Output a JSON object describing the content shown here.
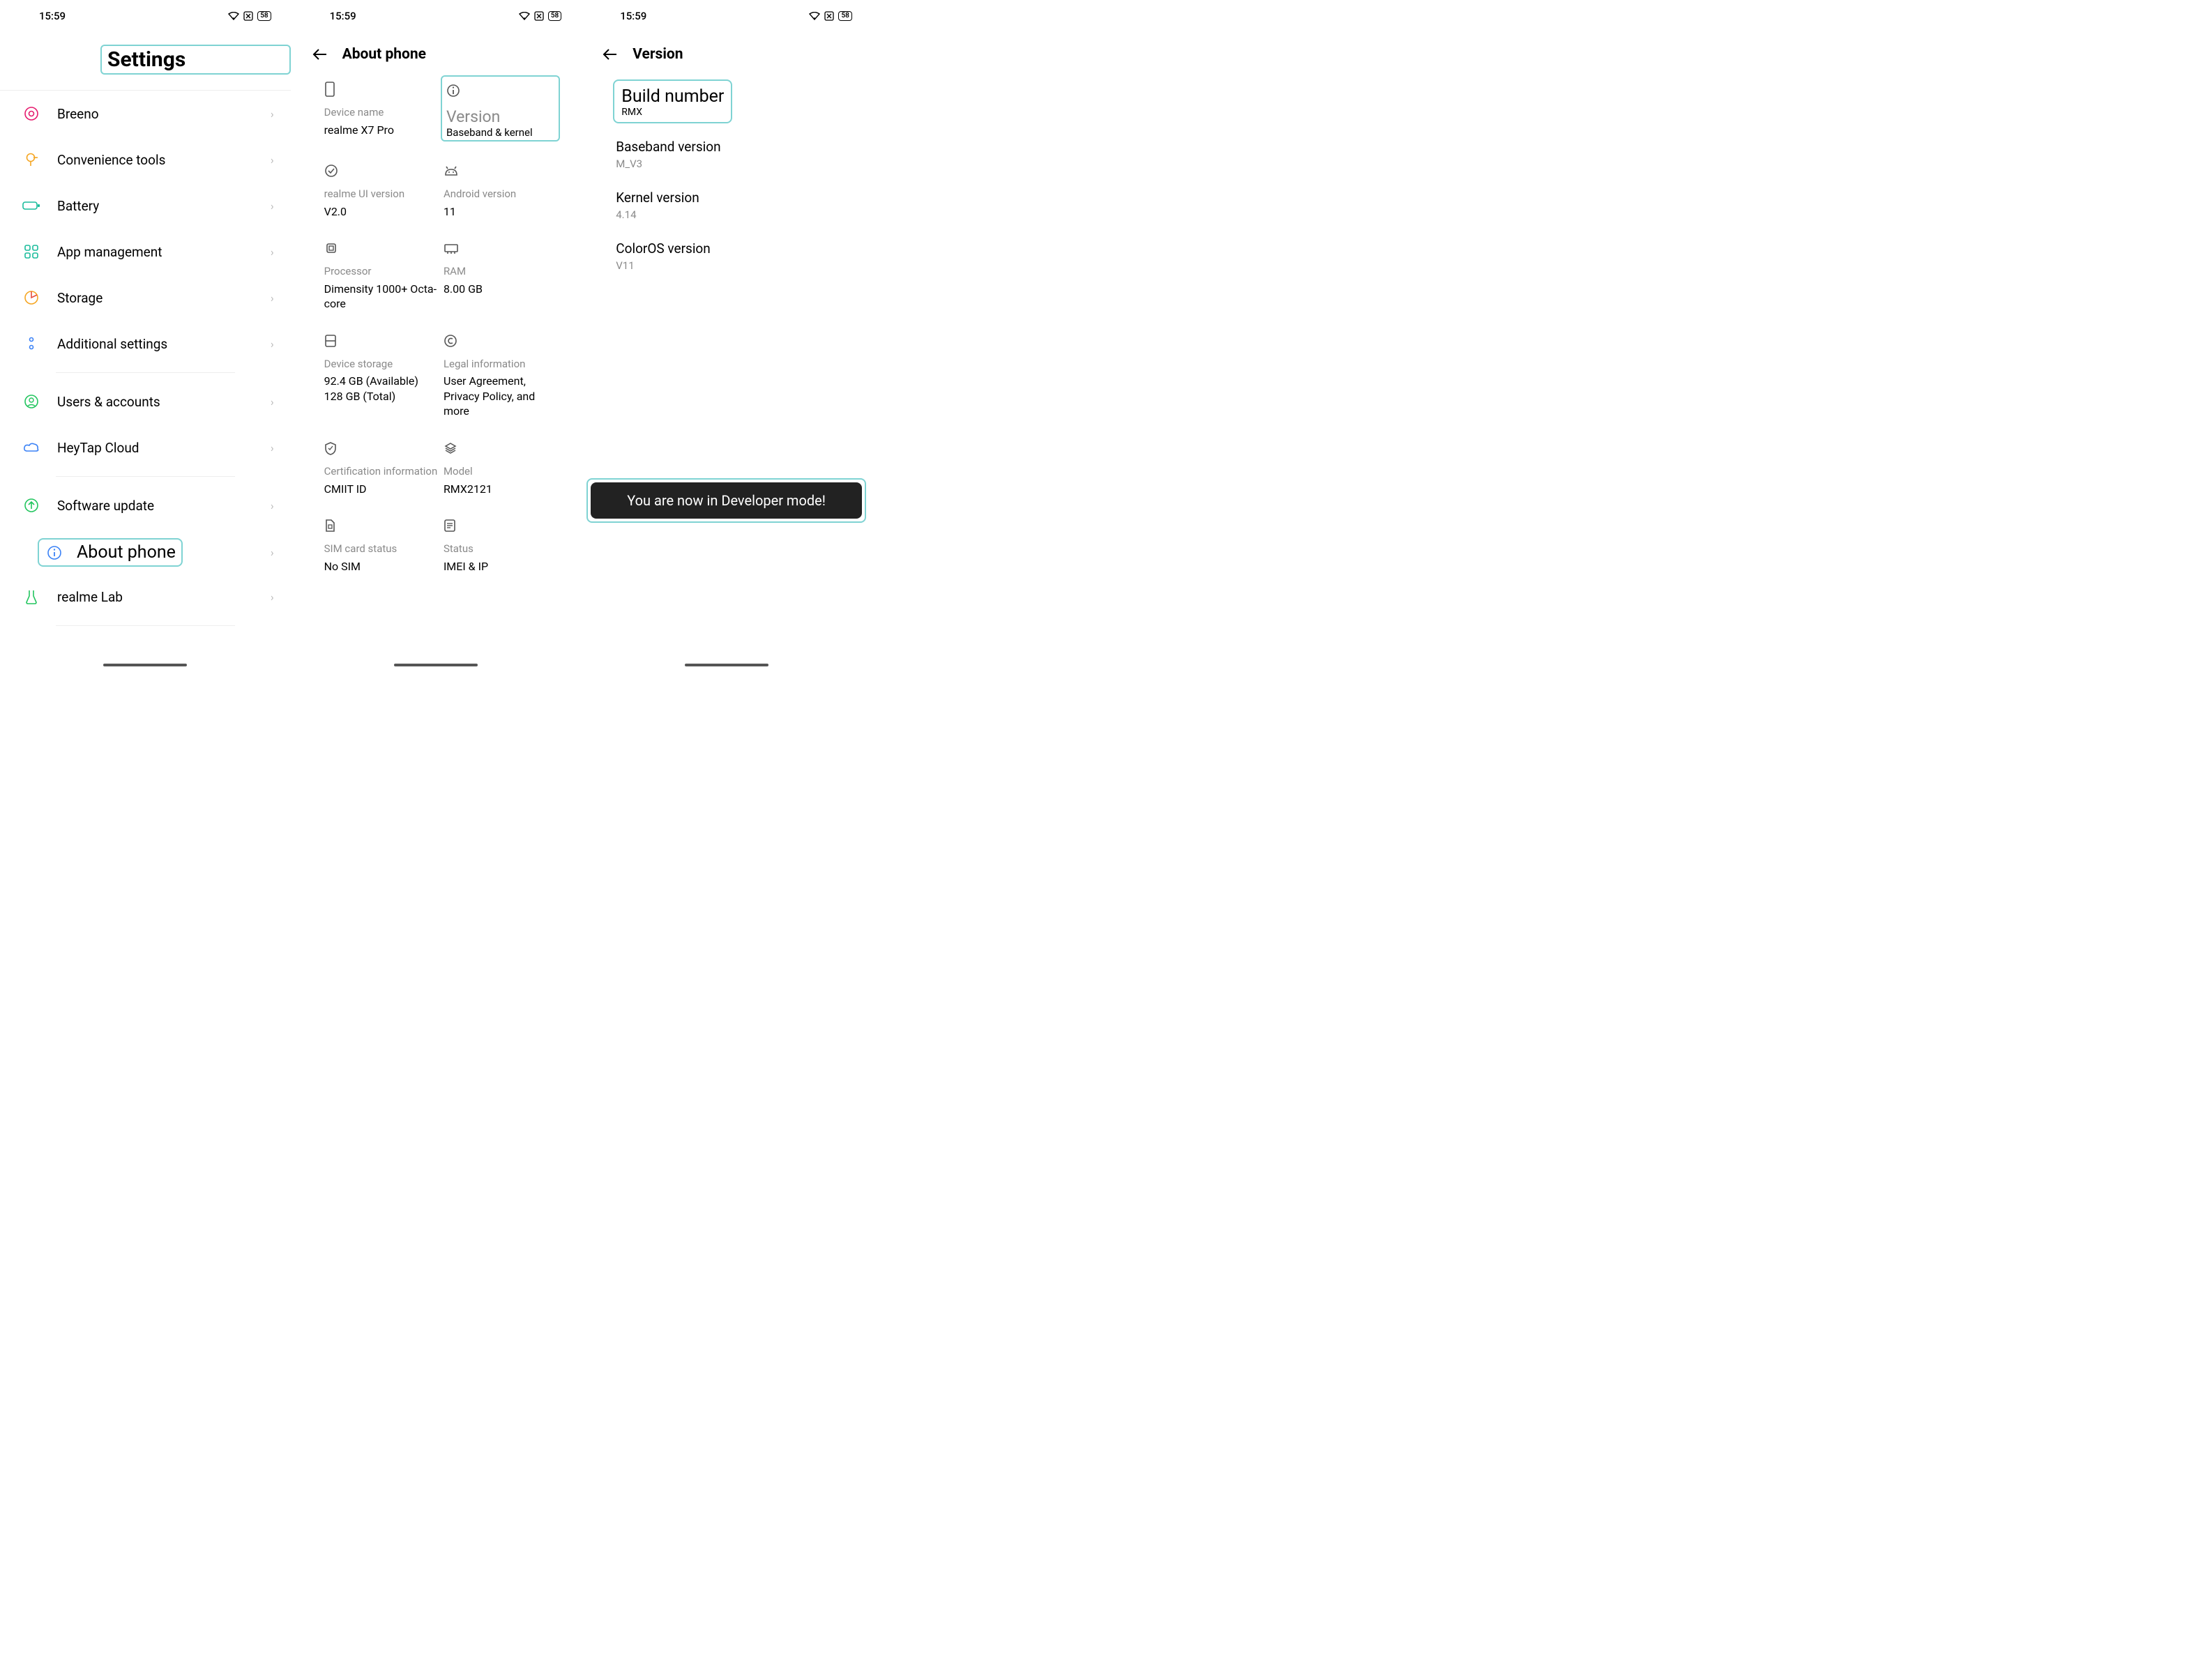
{
  "status": {
    "time": "15:59",
    "battery": "58"
  },
  "screen1": {
    "title": "Settings",
    "items": [
      {
        "label": "Breeno"
      },
      {
        "label": "Convenience tools"
      },
      {
        "label": "Battery"
      },
      {
        "label": "App management"
      },
      {
        "label": "Storage"
      },
      {
        "label": "Additional settings"
      }
    ],
    "items2": [
      {
        "label": "Users & accounts"
      },
      {
        "label": "HeyTap Cloud"
      }
    ],
    "items3": [
      {
        "label": "Software update"
      }
    ],
    "about": "About phone",
    "items4": [
      {
        "label": "realme Lab"
      }
    ]
  },
  "screen2": {
    "title": "About phone",
    "cells": {
      "device_name": {
        "label": "Device name",
        "value": "realme X7 Pro"
      },
      "version": {
        "label": "Version",
        "value": "Baseband & kernel"
      },
      "ui_version": {
        "label": "realme UI version",
        "value": "V2.0"
      },
      "android": {
        "label": "Android version",
        "value": "11"
      },
      "processor": {
        "label": "Processor",
        "value": "Dimensity 1000+ Octa-core"
      },
      "ram": {
        "label": "RAM",
        "value": "8.00 GB"
      },
      "storage": {
        "label": "Device storage",
        "value": "92.4 GB (Available) 128 GB (Total)"
      },
      "legal": {
        "label": "Legal information",
        "value": "User Agreement, Privacy Policy, and more"
      },
      "cert": {
        "label": "Certification information",
        "value": "CMIIT ID"
      },
      "model": {
        "label": "Model",
        "value": "RMX2121"
      },
      "sim": {
        "label": "SIM card status",
        "value": "No SIM"
      },
      "status": {
        "label": "Status",
        "value": "IMEI & IP"
      }
    }
  },
  "screen3": {
    "title": "Version",
    "build_label": "Build number",
    "build_value": "RMX",
    "items": [
      {
        "label": "Baseband version",
        "value": "M_V3"
      },
      {
        "label": "Kernel version",
        "value": "4.14"
      },
      {
        "label": "ColorOS version",
        "value": "V11"
      }
    ],
    "toast": "You are now in Developer mode!"
  }
}
